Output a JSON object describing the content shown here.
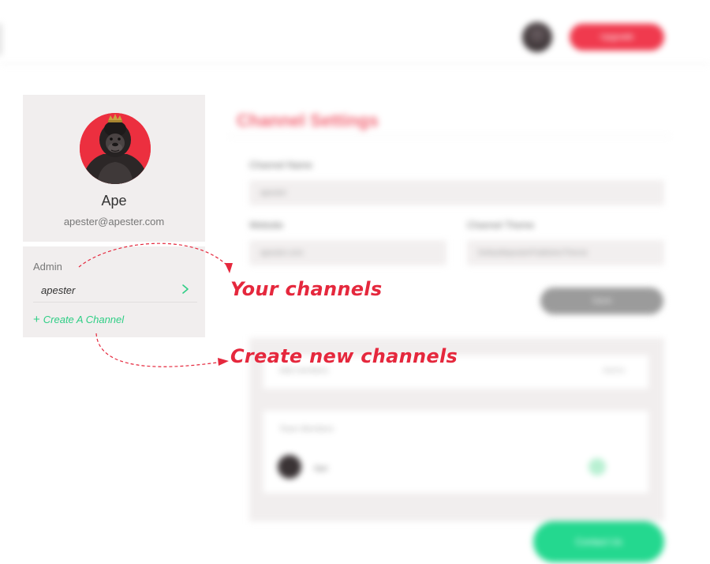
{
  "header": {
    "cta_label": "Upgrade"
  },
  "settings": {
    "title": "Channel Settings",
    "channel_name_label": "Channel Name",
    "channel_name_value": "apester",
    "website_label": "Website",
    "website_value": "apester.com",
    "channel_theme_label": "Channel Theme",
    "channel_theme_value": "DefaultApesterPublisherTheme",
    "save_label": "Save",
    "members_placeholder": "Add members",
    "members_role": "Admin",
    "team_members_label": "Team Members",
    "member_name": "Ape",
    "contact_label": "Contact Us"
  },
  "profile": {
    "name": "Ape",
    "email": "apester@apester.com"
  },
  "channels": {
    "heading": "Admin",
    "items": [
      {
        "name": "apester"
      }
    ],
    "create_label": "Create A Channel"
  },
  "annotations": {
    "your_channels": "Your channels",
    "create_new_channels": "Create new channels"
  },
  "colors": {
    "accent_red": "#e5283d",
    "accent_green": "#2fce85",
    "card_bg": "#f1eeee"
  },
  "icons": {
    "chevron": "chevron-right-icon",
    "plus": "plus-icon"
  }
}
